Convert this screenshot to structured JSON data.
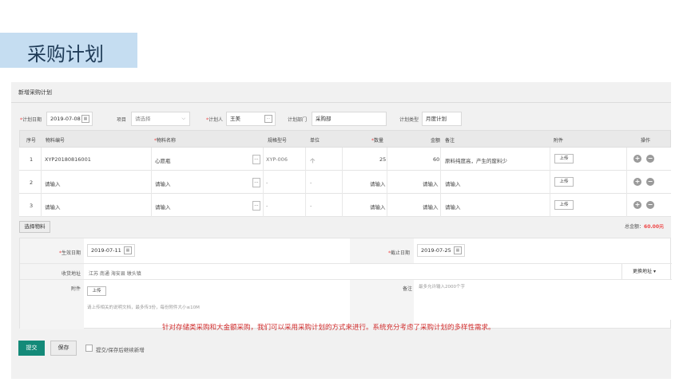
{
  "banner_title": "采购计划",
  "panel_title": "新增采购计划",
  "header_fields": {
    "plan_date_label": "计划日期",
    "plan_date_value": "2019-07-08",
    "project_label": "项目",
    "project_placeholder": "请选择",
    "planner_label": "计划人",
    "planner_value": "王美",
    "dept_label": "计划部门",
    "dept_value": "采购部",
    "type_label": "计划类型",
    "type_value": "月度计划"
  },
  "table": {
    "headers": [
      "序号",
      "物料编号",
      "物料名称",
      "规格型号",
      "单位",
      "数量",
      "金额",
      "备注",
      "附件",
      "操作"
    ],
    "rows": [
      {
        "idx": "1",
        "code": "XYP20180816001",
        "name": "心愿瓶",
        "spec": "XYP-006",
        "unit": "个",
        "qty": "25",
        "amount": "60",
        "note": "原料纯度高，产生的废料少",
        "upload": "上传"
      },
      {
        "idx": "2",
        "code": "请输入",
        "name": "请输入",
        "spec": "-",
        "unit": "-",
        "qty": "请输入",
        "amount": "请输入",
        "note": "请输入",
        "upload": "上传"
      },
      {
        "idx": "3",
        "code": "请输入",
        "name": "请输入",
        "spec": "-",
        "unit": "-",
        "qty": "请输入",
        "amount": "请输入",
        "note": "请输入",
        "upload": "上传"
      }
    ]
  },
  "select_material_label": "选择物料",
  "total_label": "总金额：",
  "total_value": "60.00元",
  "details": {
    "effective_label": "生效日期",
    "effective_value": "2019-07-11",
    "deadline_label": "截止日期",
    "deadline_value": "2019-07-25",
    "address_label": "收货地址",
    "address_value": "江苏 南通 海安县 墩头镇",
    "change_address_label": "更换地址",
    "attachment_label": "附件",
    "attachment_upload": "上传",
    "attachment_hint": "请上传相关的说明文档，最多传3份，每份附件大小≤10M",
    "remark_label": "备注",
    "remark_placeholder": "最多允许输入2000个字"
  },
  "notice": "针对存储类采购和大金额采购，我们可以采用采购计划的方式来进行。系统充分考虑了采购计划的多样性需求。",
  "actions": {
    "submit": "提交",
    "save": "保存",
    "continue_label": "提交/保存后继续新增"
  },
  "colors": {
    "banner_bg": "#c5ddf1",
    "submit_bg": "#148a79",
    "required_star": "#e44444",
    "total_value": "#e44444",
    "notice_text": "#d02c2c"
  }
}
